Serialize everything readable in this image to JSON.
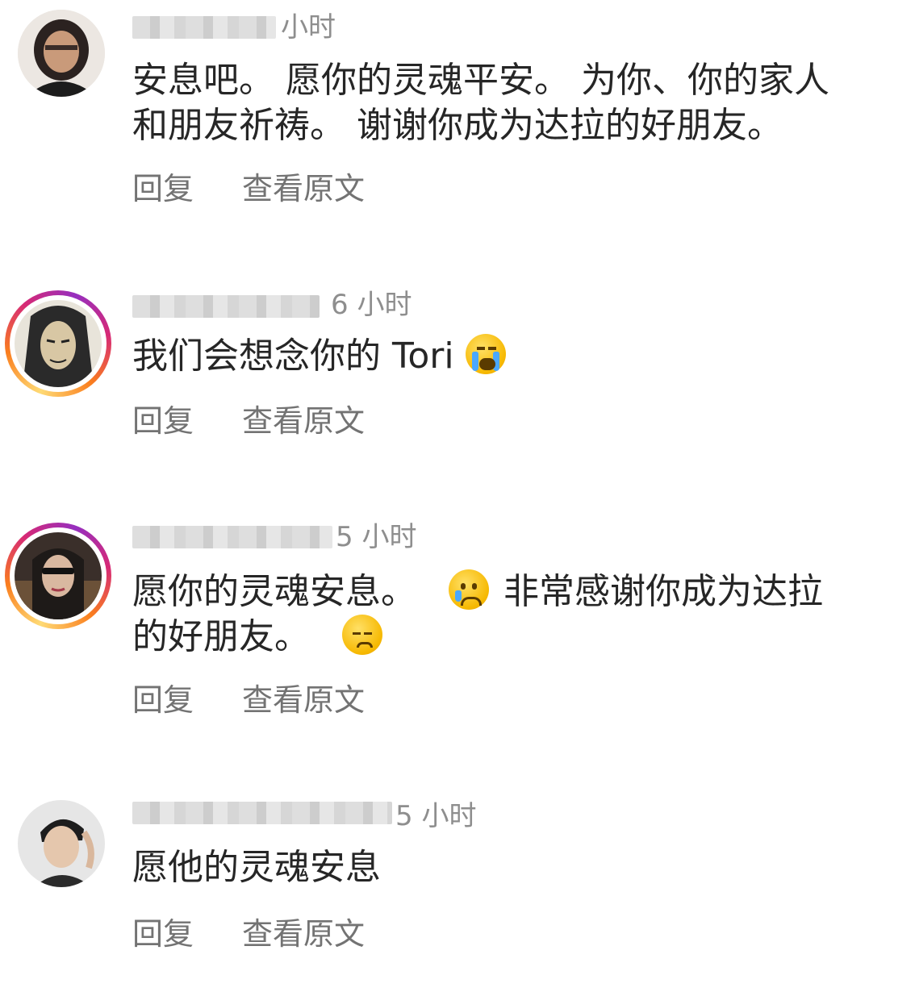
{
  "comments": [
    {
      "time": "小时",
      "text": "安息吧。 愿你的灵魂平安。 为你、你的家人\n和朋友祈祷。 谢谢你成为达拉的好朋友。",
      "emoji": "",
      "reply_label": "回复",
      "translate_label": "查看原文"
    },
    {
      "time": "6 小时",
      "text": "我们会想念你的 Tori",
      "emoji": "loudly-crying-face-emoji",
      "reply_label": "回复",
      "translate_label": "查看原文"
    },
    {
      "time": "5 小时",
      "text_line1": "愿你的灵魂安息。",
      "text_line1b": "非常感谢你成为达拉",
      "text_line2": "的好朋友。",
      "emoji1": "crying-face-emoji",
      "emoji2": "pensive-face-emoji",
      "reply_label": "回复",
      "translate_label": "查看原文"
    },
    {
      "time": "5 小时",
      "text": "愿他的灵魂安息",
      "reply_label": "回复",
      "translate_label": "查看原文"
    }
  ],
  "colors": {
    "text": "#262626",
    "muted": "#8e8e8e",
    "action": "#737373",
    "story_ring": "#d62976"
  }
}
